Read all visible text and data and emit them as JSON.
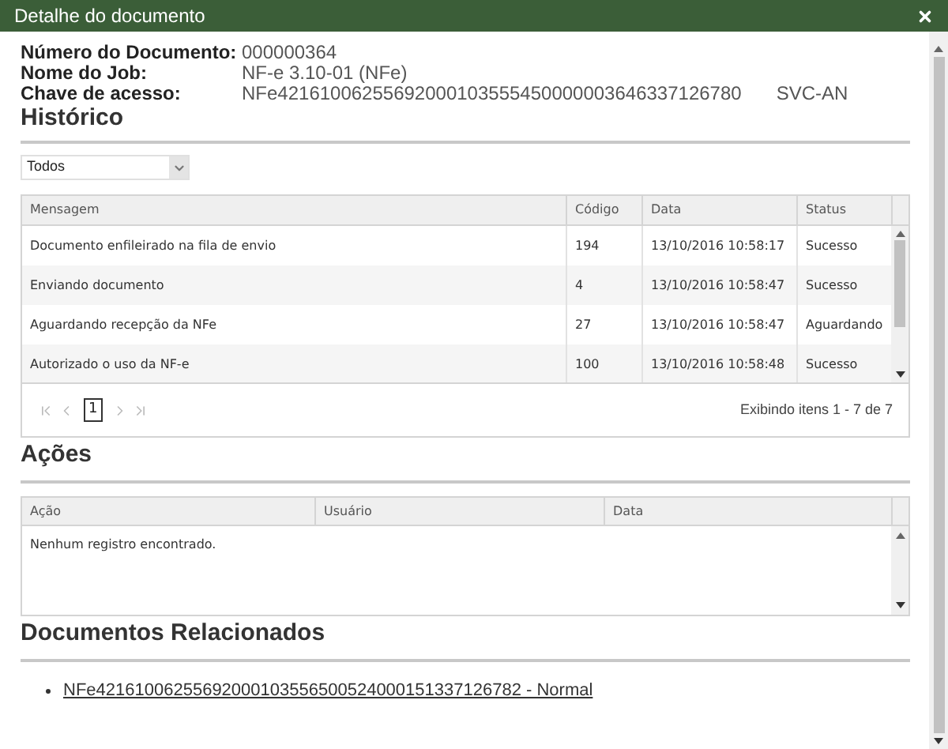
{
  "window": {
    "title": "Detalhe do documento"
  },
  "fields": [
    {
      "label": "Número do Documento:",
      "value": "000000364"
    },
    {
      "label": "Nome do Job:",
      "value": "NF-e 3.10-01 (NFe)"
    },
    {
      "label": "Chave de acesso:",
      "value": "NFe42161006255692000103555450000003646337126780",
      "extra": "SVC-AN"
    }
  ],
  "historico": {
    "title": "Histórico",
    "filter": "Todos",
    "columns": [
      "Mensagem",
      "Código",
      "Data",
      "Status"
    ],
    "rows": [
      [
        "Documento enfileirado na fila de envio",
        "194",
        "13/10/2016 10:58:17",
        "Sucesso"
      ],
      [
        "Enviando documento",
        "4",
        "13/10/2016 10:58:47",
        "Sucesso"
      ],
      [
        "Aguardando recepção da NFe",
        "27",
        "13/10/2016 10:58:47",
        "Aguardando"
      ],
      [
        "Autorizado o uso da NF-e",
        "100",
        "13/10/2016 10:58:48",
        "Sucesso"
      ]
    ],
    "pager": {
      "page": "1",
      "summary": "Exibindo itens 1 - 7 de 7"
    }
  },
  "acoes": {
    "title": "Ações",
    "columns": [
      "Ação",
      "Usuário",
      "Data"
    ],
    "empty": "Nenhum registro encontrado."
  },
  "relacionados": {
    "title": "Documentos Relacionados",
    "items": [
      "NFe42161006255692000103556500524000151337126782 - Normal"
    ]
  }
}
